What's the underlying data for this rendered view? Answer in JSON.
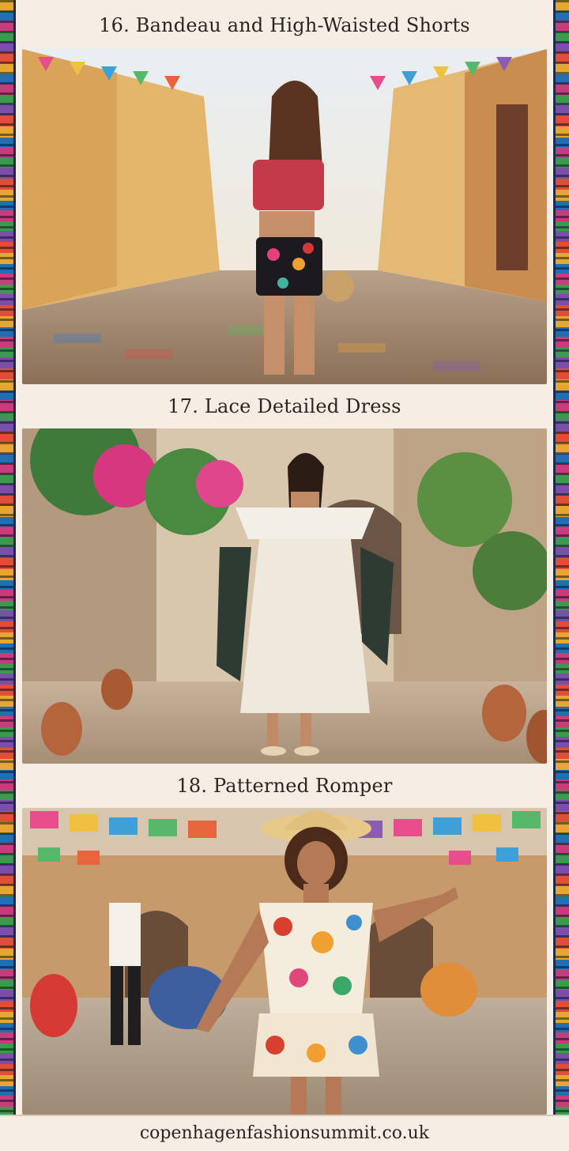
{
  "sections": [
    {
      "title": "16. Bandeau and High-Waisted Shorts"
    },
    {
      "title": "17. Lace Detailed Dress"
    },
    {
      "title": "18. Patterned Romper"
    }
  ],
  "footer": {
    "site": "copenhagenfashionsummit.co.uk"
  },
  "colors": {
    "background": "#f6eee4",
    "text": "#2a2522",
    "border_navy": "#1a2c4a"
  }
}
